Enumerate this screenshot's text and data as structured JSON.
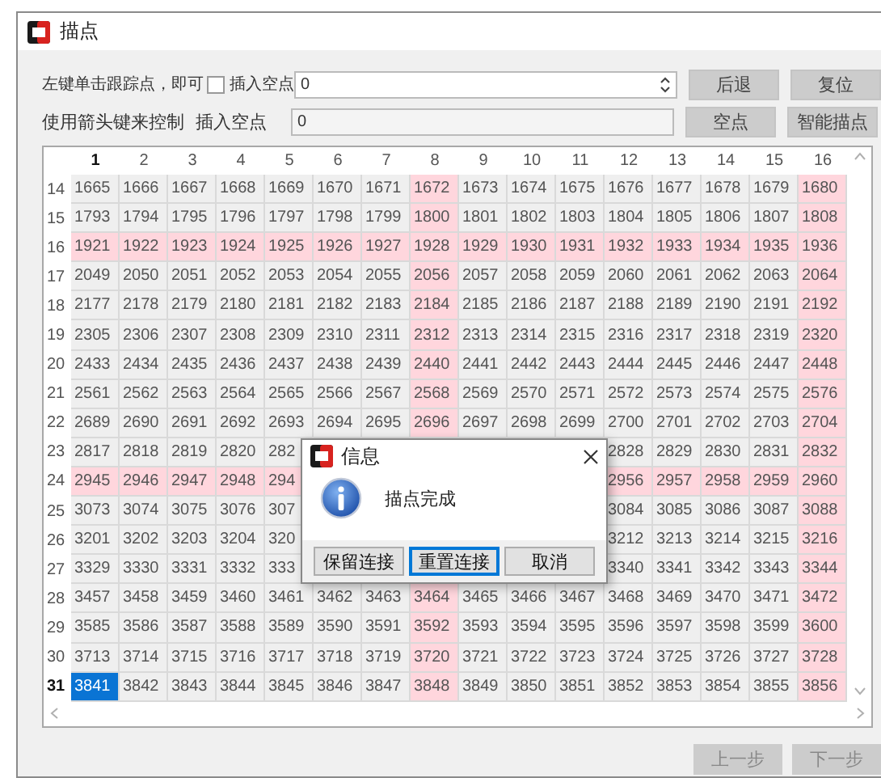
{
  "window": {
    "title": "描点"
  },
  "controls": {
    "hint_line_1": "左键单击跟踪点，即可",
    "insert_checkbox": {
      "label": "插入空点",
      "checked": false
    },
    "spin_value": "0",
    "hint_line_2": "使用箭头键来控制",
    "insert_label": "插入空点",
    "insert_value": "0",
    "buttons_row_1": [
      "后退",
      "复位"
    ],
    "buttons_row_2": [
      "空点",
      "智能描点"
    ]
  },
  "grid": {
    "columns": [
      {
        "label": "1",
        "marked": false,
        "current": true
      },
      {
        "label": "2",
        "marked": false,
        "current": false
      },
      {
        "label": "3",
        "marked": false,
        "current": false
      },
      {
        "label": "4",
        "marked": false,
        "current": false
      },
      {
        "label": "5",
        "marked": false,
        "current": false
      },
      {
        "label": "6",
        "marked": false,
        "current": false
      },
      {
        "label": "7",
        "marked": false,
        "current": false
      },
      {
        "label": "8",
        "marked": true,
        "current": false
      },
      {
        "label": "9",
        "marked": false,
        "current": false
      },
      {
        "label": "10",
        "marked": false,
        "current": false
      },
      {
        "label": "11",
        "marked": false,
        "current": false
      },
      {
        "label": "12",
        "marked": false,
        "current": false
      },
      {
        "label": "13",
        "marked": false,
        "current": false
      },
      {
        "label": "14",
        "marked": false,
        "current": false
      },
      {
        "label": "15",
        "marked": false,
        "current": false
      },
      {
        "label": "16",
        "marked": true,
        "current": false
      }
    ],
    "rows": [
      {
        "label": "14",
        "marked": false,
        "current": false,
        "cells": [
          {
            "text": "1665",
            "selected": false
          },
          {
            "text": "1666",
            "selected": false
          },
          {
            "text": "1667",
            "selected": false
          },
          {
            "text": "1668",
            "selected": false
          },
          {
            "text": "1669",
            "selected": false
          },
          {
            "text": "1670",
            "selected": false
          },
          {
            "text": "1671",
            "selected": false
          },
          {
            "text": "1672",
            "selected": false
          },
          {
            "text": "1673",
            "selected": false
          },
          {
            "text": "1674",
            "selected": false
          },
          {
            "text": "1675",
            "selected": false
          },
          {
            "text": "1676",
            "selected": false
          },
          {
            "text": "1677",
            "selected": false
          },
          {
            "text": "1678",
            "selected": false
          },
          {
            "text": "1679",
            "selected": false
          },
          {
            "text": "1680",
            "selected": false
          }
        ]
      },
      {
        "label": "15",
        "marked": false,
        "current": false,
        "cells": [
          {
            "text": "1793",
            "selected": false
          },
          {
            "text": "1794",
            "selected": false
          },
          {
            "text": "1795",
            "selected": false
          },
          {
            "text": "1796",
            "selected": false
          },
          {
            "text": "1797",
            "selected": false
          },
          {
            "text": "1798",
            "selected": false
          },
          {
            "text": "1799",
            "selected": false
          },
          {
            "text": "1800",
            "selected": false
          },
          {
            "text": "1801",
            "selected": false
          },
          {
            "text": "1802",
            "selected": false
          },
          {
            "text": "1803",
            "selected": false
          },
          {
            "text": "1804",
            "selected": false
          },
          {
            "text": "1805",
            "selected": false
          },
          {
            "text": "1806",
            "selected": false
          },
          {
            "text": "1807",
            "selected": false
          },
          {
            "text": "1808",
            "selected": false
          }
        ]
      },
      {
        "label": "16",
        "marked": true,
        "current": false,
        "cells": [
          {
            "text": "1921",
            "selected": false
          },
          {
            "text": "1922",
            "selected": false
          },
          {
            "text": "1923",
            "selected": false
          },
          {
            "text": "1924",
            "selected": false
          },
          {
            "text": "1925",
            "selected": false
          },
          {
            "text": "1926",
            "selected": false
          },
          {
            "text": "1927",
            "selected": false
          },
          {
            "text": "1928",
            "selected": false
          },
          {
            "text": "1929",
            "selected": false
          },
          {
            "text": "1930",
            "selected": false
          },
          {
            "text": "1931",
            "selected": false
          },
          {
            "text": "1932",
            "selected": false
          },
          {
            "text": "1933",
            "selected": false
          },
          {
            "text": "1934",
            "selected": false
          },
          {
            "text": "1935",
            "selected": false
          },
          {
            "text": "1936",
            "selected": false
          }
        ]
      },
      {
        "label": "17",
        "marked": false,
        "current": false,
        "cells": [
          {
            "text": "2049",
            "selected": false
          },
          {
            "text": "2050",
            "selected": false
          },
          {
            "text": "2051",
            "selected": false
          },
          {
            "text": "2052",
            "selected": false
          },
          {
            "text": "2053",
            "selected": false
          },
          {
            "text": "2054",
            "selected": false
          },
          {
            "text": "2055",
            "selected": false
          },
          {
            "text": "2056",
            "selected": false
          },
          {
            "text": "2057",
            "selected": false
          },
          {
            "text": "2058",
            "selected": false
          },
          {
            "text": "2059",
            "selected": false
          },
          {
            "text": "2060",
            "selected": false
          },
          {
            "text": "2061",
            "selected": false
          },
          {
            "text": "2062",
            "selected": false
          },
          {
            "text": "2063",
            "selected": false
          },
          {
            "text": "2064",
            "selected": false
          }
        ]
      },
      {
        "label": "18",
        "marked": false,
        "current": false,
        "cells": [
          {
            "text": "2177",
            "selected": false
          },
          {
            "text": "2178",
            "selected": false
          },
          {
            "text": "2179",
            "selected": false
          },
          {
            "text": "2180",
            "selected": false
          },
          {
            "text": "2181",
            "selected": false
          },
          {
            "text": "2182",
            "selected": false
          },
          {
            "text": "2183",
            "selected": false
          },
          {
            "text": "2184",
            "selected": false
          },
          {
            "text": "2185",
            "selected": false
          },
          {
            "text": "2186",
            "selected": false
          },
          {
            "text": "2187",
            "selected": false
          },
          {
            "text": "2188",
            "selected": false
          },
          {
            "text": "2189",
            "selected": false
          },
          {
            "text": "2190",
            "selected": false
          },
          {
            "text": "2191",
            "selected": false
          },
          {
            "text": "2192",
            "selected": false
          }
        ]
      },
      {
        "label": "19",
        "marked": false,
        "current": false,
        "cells": [
          {
            "text": "2305",
            "selected": false
          },
          {
            "text": "2306",
            "selected": false
          },
          {
            "text": "2307",
            "selected": false
          },
          {
            "text": "2308",
            "selected": false
          },
          {
            "text": "2309",
            "selected": false
          },
          {
            "text": "2310",
            "selected": false
          },
          {
            "text": "2311",
            "selected": false
          },
          {
            "text": "2312",
            "selected": false
          },
          {
            "text": "2313",
            "selected": false
          },
          {
            "text": "2314",
            "selected": false
          },
          {
            "text": "2315",
            "selected": false
          },
          {
            "text": "2316",
            "selected": false
          },
          {
            "text": "2317",
            "selected": false
          },
          {
            "text": "2318",
            "selected": false
          },
          {
            "text": "2319",
            "selected": false
          },
          {
            "text": "2320",
            "selected": false
          }
        ]
      },
      {
        "label": "20",
        "marked": false,
        "current": false,
        "cells": [
          {
            "text": "2433",
            "selected": false
          },
          {
            "text": "2434",
            "selected": false
          },
          {
            "text": "2435",
            "selected": false
          },
          {
            "text": "2436",
            "selected": false
          },
          {
            "text": "2437",
            "selected": false
          },
          {
            "text": "2438",
            "selected": false
          },
          {
            "text": "2439",
            "selected": false
          },
          {
            "text": "2440",
            "selected": false
          },
          {
            "text": "2441",
            "selected": false
          },
          {
            "text": "2442",
            "selected": false
          },
          {
            "text": "2443",
            "selected": false
          },
          {
            "text": "2444",
            "selected": false
          },
          {
            "text": "2445",
            "selected": false
          },
          {
            "text": "2446",
            "selected": false
          },
          {
            "text": "2447",
            "selected": false
          },
          {
            "text": "2448",
            "selected": false
          }
        ]
      },
      {
        "label": "21",
        "marked": false,
        "current": false,
        "cells": [
          {
            "text": "2561",
            "selected": false
          },
          {
            "text": "2562",
            "selected": false
          },
          {
            "text": "2563",
            "selected": false
          },
          {
            "text": "2564",
            "selected": false
          },
          {
            "text": "2565",
            "selected": false
          },
          {
            "text": "2566",
            "selected": false
          },
          {
            "text": "2567",
            "selected": false
          },
          {
            "text": "2568",
            "selected": false
          },
          {
            "text": "2569",
            "selected": false
          },
          {
            "text": "2570",
            "selected": false
          },
          {
            "text": "2571",
            "selected": false
          },
          {
            "text": "2572",
            "selected": false
          },
          {
            "text": "2573",
            "selected": false
          },
          {
            "text": "2574",
            "selected": false
          },
          {
            "text": "2575",
            "selected": false
          },
          {
            "text": "2576",
            "selected": false
          }
        ]
      },
      {
        "label": "22",
        "marked": false,
        "current": false,
        "cells": [
          {
            "text": "2689",
            "selected": false
          },
          {
            "text": "2690",
            "selected": false
          },
          {
            "text": "2691",
            "selected": false
          },
          {
            "text": "2692",
            "selected": false
          },
          {
            "text": "2693",
            "selected": false
          },
          {
            "text": "2694",
            "selected": false
          },
          {
            "text": "2695",
            "selected": false
          },
          {
            "text": "2696",
            "selected": false
          },
          {
            "text": "2697",
            "selected": false
          },
          {
            "text": "2698",
            "selected": false
          },
          {
            "text": "2699",
            "selected": false
          },
          {
            "text": "2700",
            "selected": false
          },
          {
            "text": "2701",
            "selected": false
          },
          {
            "text": "2702",
            "selected": false
          },
          {
            "text": "2703",
            "selected": false
          },
          {
            "text": "2704",
            "selected": false
          }
        ]
      },
      {
        "label": "23",
        "marked": false,
        "current": false,
        "cells": [
          {
            "text": "2817",
            "selected": false
          },
          {
            "text": "2818",
            "selected": false
          },
          {
            "text": "2819",
            "selected": false
          },
          {
            "text": "2820",
            "selected": false
          },
          {
            "text": "282",
            "selected": false
          },
          null,
          null,
          null,
          null,
          null,
          null,
          {
            "text": "2828",
            "selected": false
          },
          {
            "text": "2829",
            "selected": false
          },
          {
            "text": "2830",
            "selected": false
          },
          {
            "text": "2831",
            "selected": false
          },
          {
            "text": "2832",
            "selected": false
          }
        ]
      },
      {
        "label": "24",
        "marked": true,
        "current": false,
        "cells": [
          {
            "text": "2945",
            "selected": false
          },
          {
            "text": "2946",
            "selected": false
          },
          {
            "text": "2947",
            "selected": false
          },
          {
            "text": "2948",
            "selected": false
          },
          {
            "text": "294",
            "selected": false
          },
          null,
          null,
          null,
          null,
          null,
          null,
          {
            "text": "2956",
            "selected": false
          },
          {
            "text": "2957",
            "selected": false
          },
          {
            "text": "2958",
            "selected": false
          },
          {
            "text": "2959",
            "selected": false
          },
          {
            "text": "2960",
            "selected": false
          }
        ]
      },
      {
        "label": "25",
        "marked": false,
        "current": false,
        "cells": [
          {
            "text": "3073",
            "selected": false
          },
          {
            "text": "3074",
            "selected": false
          },
          {
            "text": "3075",
            "selected": false
          },
          {
            "text": "3076",
            "selected": false
          },
          {
            "text": "307",
            "selected": false
          },
          null,
          null,
          null,
          null,
          null,
          null,
          {
            "text": "3084",
            "selected": false
          },
          {
            "text": "3085",
            "selected": false
          },
          {
            "text": "3086",
            "selected": false
          },
          {
            "text": "3087",
            "selected": false
          },
          {
            "text": "3088",
            "selected": false
          }
        ]
      },
      {
        "label": "26",
        "marked": false,
        "current": false,
        "cells": [
          {
            "text": "3201",
            "selected": false
          },
          {
            "text": "3202",
            "selected": false
          },
          {
            "text": "3203",
            "selected": false
          },
          {
            "text": "3204",
            "selected": false
          },
          {
            "text": "320",
            "selected": false
          },
          null,
          null,
          null,
          null,
          null,
          null,
          {
            "text": "3212",
            "selected": false
          },
          {
            "text": "3213",
            "selected": false
          },
          {
            "text": "3214",
            "selected": false
          },
          {
            "text": "3215",
            "selected": false
          },
          {
            "text": "3216",
            "selected": false
          }
        ]
      },
      {
        "label": "27",
        "marked": false,
        "current": false,
        "cells": [
          {
            "text": "3329",
            "selected": false
          },
          {
            "text": "3330",
            "selected": false
          },
          {
            "text": "3331",
            "selected": false
          },
          {
            "text": "3332",
            "selected": false
          },
          {
            "text": "333",
            "selected": false
          },
          null,
          null,
          null,
          null,
          null,
          null,
          {
            "text": "3340",
            "selected": false
          },
          {
            "text": "3341",
            "selected": false
          },
          {
            "text": "3342",
            "selected": false
          },
          {
            "text": "3343",
            "selected": false
          },
          {
            "text": "3344",
            "selected": false
          }
        ]
      },
      {
        "label": "28",
        "marked": false,
        "current": false,
        "cells": [
          {
            "text": "3457",
            "selected": false
          },
          {
            "text": "3458",
            "selected": false
          },
          {
            "text": "3459",
            "selected": false
          },
          {
            "text": "3460",
            "selected": false
          },
          {
            "text": "3461",
            "selected": false
          },
          {
            "text": "3462",
            "selected": false
          },
          {
            "text": "3463",
            "selected": false
          },
          {
            "text": "3464",
            "selected": false
          },
          {
            "text": "3465",
            "selected": false
          },
          {
            "text": "3466",
            "selected": false
          },
          {
            "text": "3467",
            "selected": false
          },
          {
            "text": "3468",
            "selected": false
          },
          {
            "text": "3469",
            "selected": false
          },
          {
            "text": "3470",
            "selected": false
          },
          {
            "text": "3471",
            "selected": false
          },
          {
            "text": "3472",
            "selected": false
          }
        ]
      },
      {
        "label": "29",
        "marked": false,
        "current": false,
        "cells": [
          {
            "text": "3585",
            "selected": false
          },
          {
            "text": "3586",
            "selected": false
          },
          {
            "text": "3587",
            "selected": false
          },
          {
            "text": "3588",
            "selected": false
          },
          {
            "text": "3589",
            "selected": false
          },
          {
            "text": "3590",
            "selected": false
          },
          {
            "text": "3591",
            "selected": false
          },
          {
            "text": "3592",
            "selected": false
          },
          {
            "text": "3593",
            "selected": false
          },
          {
            "text": "3594",
            "selected": false
          },
          {
            "text": "3595",
            "selected": false
          },
          {
            "text": "3596",
            "selected": false
          },
          {
            "text": "3597",
            "selected": false
          },
          {
            "text": "3598",
            "selected": false
          },
          {
            "text": "3599",
            "selected": false
          },
          {
            "text": "3600",
            "selected": false
          }
        ]
      },
      {
        "label": "30",
        "marked": false,
        "current": false,
        "cells": [
          {
            "text": "3713",
            "selected": false
          },
          {
            "text": "3714",
            "selected": false
          },
          {
            "text": "3715",
            "selected": false
          },
          {
            "text": "3716",
            "selected": false
          },
          {
            "text": "3717",
            "selected": false
          },
          {
            "text": "3718",
            "selected": false
          },
          {
            "text": "3719",
            "selected": false
          },
          {
            "text": "3720",
            "selected": false
          },
          {
            "text": "3721",
            "selected": false
          },
          {
            "text": "3722",
            "selected": false
          },
          {
            "text": "3723",
            "selected": false
          },
          {
            "text": "3724",
            "selected": false
          },
          {
            "text": "3725",
            "selected": false
          },
          {
            "text": "3726",
            "selected": false
          },
          {
            "text": "3727",
            "selected": false
          },
          {
            "text": "3728",
            "selected": false
          }
        ]
      },
      {
        "label": "31",
        "marked": false,
        "current": true,
        "cells": [
          {
            "text": "3841",
            "selected": true
          },
          {
            "text": "3842",
            "selected": false
          },
          {
            "text": "3843",
            "selected": false
          },
          {
            "text": "3844",
            "selected": false
          },
          {
            "text": "3845",
            "selected": false
          },
          {
            "text": "3846",
            "selected": false
          },
          {
            "text": "3847",
            "selected": false
          },
          {
            "text": "3848",
            "selected": false
          },
          {
            "text": "3849",
            "selected": false
          },
          {
            "text": "3850",
            "selected": false
          },
          {
            "text": "3851",
            "selected": false
          },
          {
            "text": "3852",
            "selected": false
          },
          {
            "text": "3853",
            "selected": false
          },
          {
            "text": "3854",
            "selected": false
          },
          {
            "text": "3855",
            "selected": false
          },
          {
            "text": "3856",
            "selected": false
          }
        ]
      }
    ]
  },
  "dialog": {
    "title": "信息",
    "message": "描点完成",
    "buttons": [
      {
        "label": "保留连接",
        "selected": false
      },
      {
        "label": "重置连接",
        "selected": true
      },
      {
        "label": "取消",
        "selected": false
      }
    ]
  },
  "footer_buttons": [
    {
      "label": "上一步",
      "disabled": true
    },
    {
      "label": "下一步",
      "disabled": true
    }
  ]
}
